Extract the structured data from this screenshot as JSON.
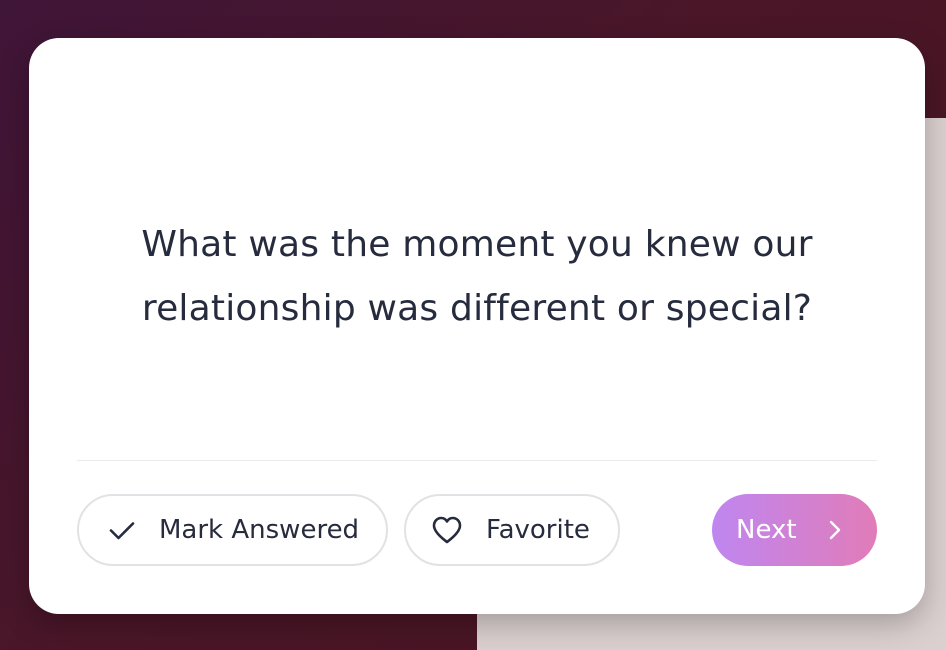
{
  "card": {
    "question": "What was the moment you knew our relationship was different or special?"
  },
  "actions": {
    "mark_answered": {
      "label": "Mark Answered",
      "icon": "check-icon"
    },
    "favorite": {
      "label": "Favorite",
      "icon": "heart-icon"
    },
    "next": {
      "label": "Next",
      "icon": "chevron-right-icon"
    }
  },
  "colors": {
    "background_start": "#3f1538",
    "background_end": "#4a1522",
    "card": "#ffffff",
    "text": "#262b3d",
    "next_gradient_start": "#bf86f0",
    "next_gradient_end": "#e17cb8"
  }
}
